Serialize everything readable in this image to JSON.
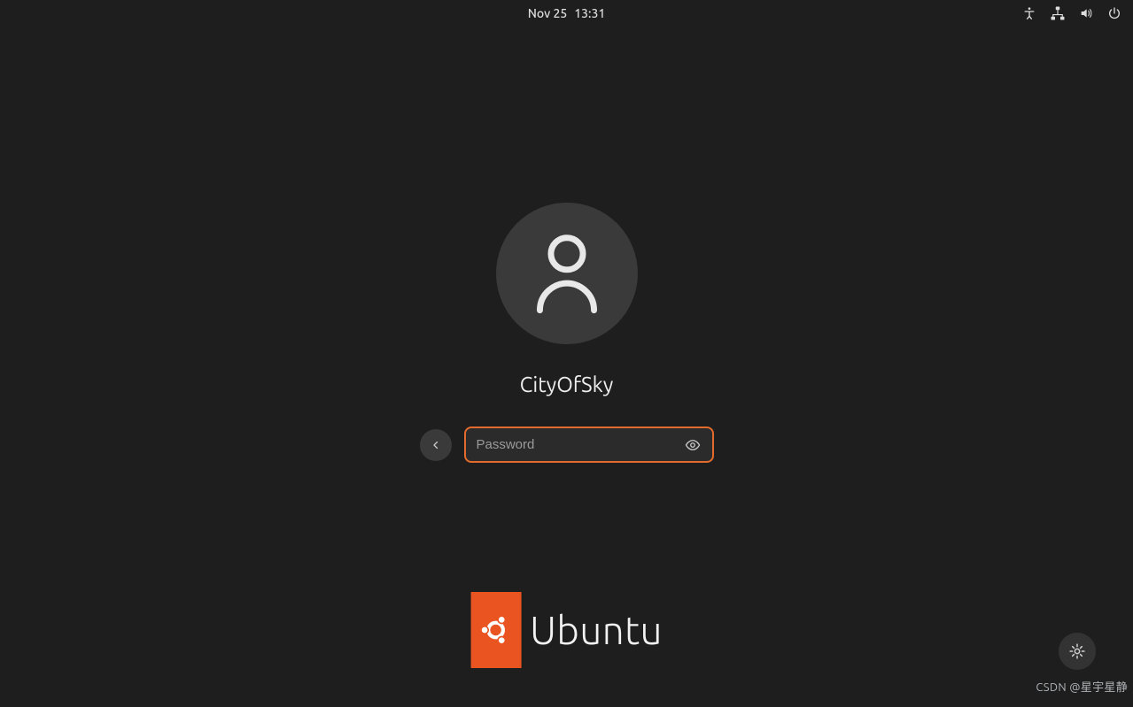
{
  "topbar": {
    "date": "Nov 25",
    "time": "13:31",
    "icons": {
      "accessibility": "accessibility-icon",
      "network": "network-wired-icon",
      "volume": "volume-icon",
      "power": "power-icon"
    }
  },
  "login": {
    "username": "CityOfSky",
    "password_placeholder": "Password",
    "password_value": "",
    "back_icon": "chevron-left-icon",
    "reveal_icon": "eye-icon"
  },
  "brand": {
    "text": "Ubuntu",
    "accent_color": "#e95420"
  },
  "session": {
    "gear_icon": "gear-icon"
  },
  "watermark": "CSDN @星宇星静"
}
